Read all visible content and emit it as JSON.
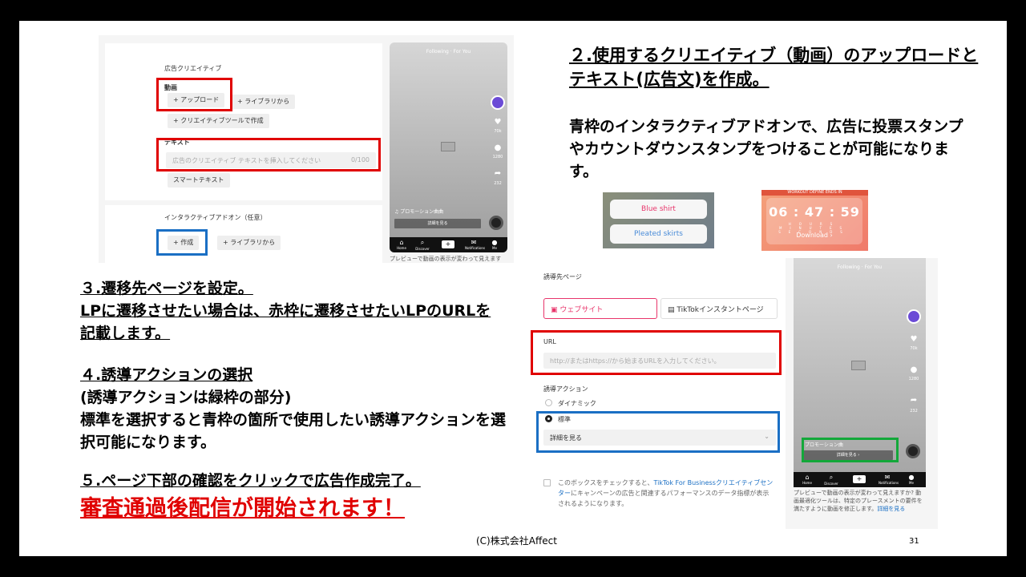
{
  "shot1": {
    "section_title": "広告クリエイティブ",
    "video_label": "動画",
    "upload_btn": "+ アップロード",
    "library_btn": "+ ライブラリから",
    "creative_tool_btn": "+ クリエイティブツールで作成",
    "text_label": "テキスト",
    "text_placeholder": "広告のクリエイティブ テキストを挿入してください",
    "text_counter": "0/100",
    "smart_text_btn": "スマートテキスト",
    "addon_label": "インタラクティブアドオン（任意）",
    "create_btn": "+ 作成",
    "addon_library_btn": "+ ライブラリから",
    "phone": {
      "tabs_top": "Following · For You",
      "likes": "70k",
      "comments": "1280",
      "shares": "232",
      "promo_label": "♫ プロモーション曲曲",
      "detail_btn": "詳細を見る",
      "nav": [
        "Home",
        "Discover",
        "+",
        "Notifications",
        "Me"
      ]
    },
    "caption": "プレビューで動画の表示が変わって見えます"
  },
  "step2": {
    "heading": "２.使用するクリエイティブ（動画）のアップロードとテキスト(広告文)を作成。",
    "desc": "青枠のインタラクティブアドオンで、広告に投票スタンプやカウントダウンスタンプをつけることが可能になります。"
  },
  "stickers": {
    "option1": "Blue shirt",
    "option2": "Pleated skirts",
    "countdown_header": "WORKOUT DEFINE ENDS IN",
    "countdown": "06 : 47 : 59",
    "countdown_units": "HOURS MINUTES SECONDS",
    "download": "Download ›"
  },
  "step3": {
    "heading": "３.遷移先ページを設定。",
    "line2": "LPに遷移させたい場合は、赤枠に遷移させたいLPのURLを記載します。"
  },
  "step4": {
    "heading": "４.誘導アクションの選択",
    "note": "(誘導アクションは緑枠の部分)",
    "desc": "標準を選択すると青枠の箇所で使用したい誘導アクションを選択可能になります。"
  },
  "step5": {
    "heading": "５.ページ下部の確認をクリックで広告作成完了。",
    "final": "審査通過後配信が開始されます！"
  },
  "shot2": {
    "section_title": "誘導先ページ",
    "website_tab": "ウェブサイト",
    "instant_tab": "TikTokインスタントページ",
    "url_label": "URL",
    "url_placeholder": "http://またはhttps://から始まるURLを入力してください。",
    "cta_label": "誘導アクション",
    "dynamic": "ダイナミック",
    "standard": "標準",
    "cta_select": "詳細を見る",
    "checkbox_text_a": "このボックスをチェックすると、",
    "checkbox_link": "TikTok For Businessクリエイティブセンター",
    "checkbox_text_b": "にキャンペーンの広告と関連するパフォーマンスのデータ指標が表示されるようになります。",
    "phone": {
      "tabs_top": "Following · For You",
      "likes": "70k",
      "comments": "1280",
      "shares": "232",
      "promo_label": "プロモーション曲",
      "detail_btn": "詳細を見る ›",
      "nav": [
        "Home",
        "Discover",
        "+",
        "Notifications",
        "Me"
      ]
    },
    "caption": "プレビューで動画の表示が変わって見えますか? 動画最適化ツールは、特定のプレースメントの要件を満たすように動画を修正します。",
    "caption_link": "詳細を見る"
  },
  "footer": "(C)株式会社Affect",
  "page_number": "31",
  "colors": {
    "red_frame": "#e00000",
    "blue_frame": "#1a6fc4",
    "green_frame": "#13a83a",
    "accent_pink": "#e8356b"
  }
}
